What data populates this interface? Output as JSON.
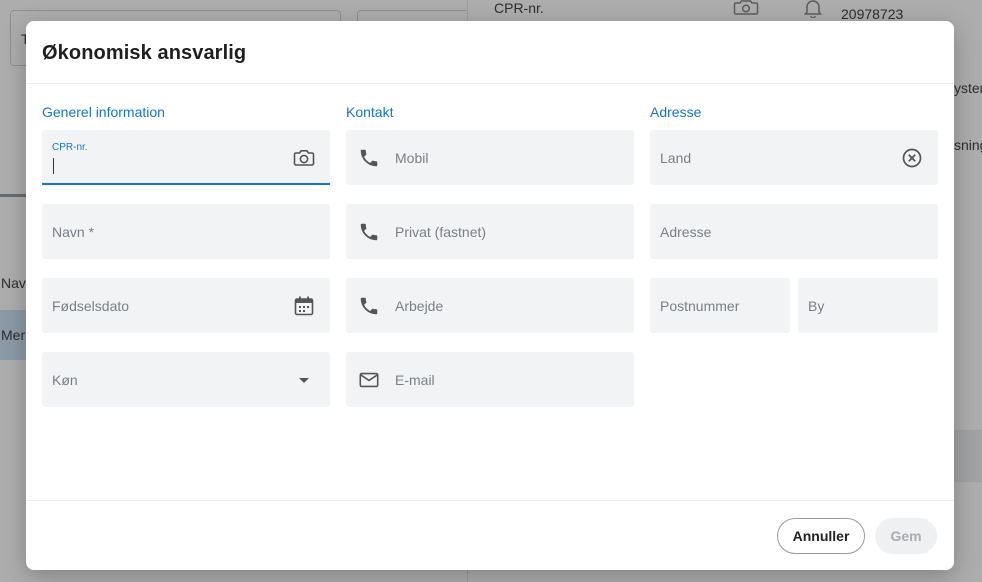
{
  "background": {
    "left_field_letter": "T",
    "nav_label": "Nav",
    "band_label": "Mer",
    "right_field_label": "CPR-nr.",
    "phone_number": "20978723",
    "right_text_1": "yster",
    "right_text_2": "sning"
  },
  "dialog": {
    "title": "Økonomisk ansvarlig",
    "sections": {
      "general": "Generel information",
      "contact": "Kontakt",
      "address": "Adresse"
    },
    "general_fields": {
      "cpr": "CPR-nr.",
      "name": "Navn *",
      "birthdate": "Fødselsdato",
      "gender": "Køn"
    },
    "contact_fields": {
      "mobile": "Mobil",
      "private": "Privat (fastnet)",
      "work": "Arbejde",
      "email": "E-mail"
    },
    "address_fields": {
      "country": "Land",
      "address": "Adresse",
      "postal_code": "Postnummer",
      "city": "By"
    },
    "buttons": {
      "cancel": "Annuller",
      "save": "Gem"
    }
  },
  "colors": {
    "accent": "#1674c8",
    "field_bg": "#f1f3f5",
    "overlay": "rgba(0,0,0,0.32)"
  }
}
